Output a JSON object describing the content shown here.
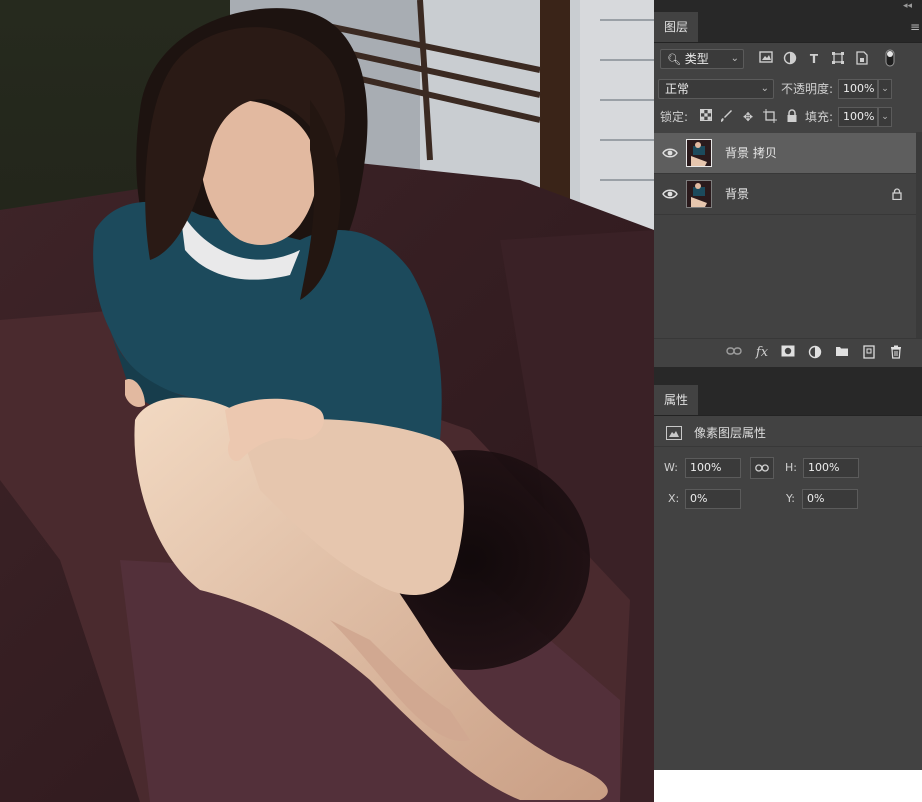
{
  "layers_panel": {
    "tab_label": "图层",
    "filter": {
      "kind_label": "类型"
    },
    "blend_mode": "正常",
    "opacity_label": "不透明度:",
    "opacity_value": "100%",
    "lock_label": "锁定:",
    "fill_label": "填充:",
    "fill_value": "100%",
    "layers": [
      {
        "name": "背景 拷贝",
        "selected": true,
        "locked": false
      },
      {
        "name": "背景",
        "selected": false,
        "locked": true
      }
    ],
    "footer_icons": [
      "link-icon",
      "fx-icon",
      "mask-icon",
      "adjustment-icon",
      "folder-icon",
      "new-layer-icon",
      "trash-icon"
    ]
  },
  "properties_panel": {
    "tab_label": "属性",
    "section_title": "像素图层属性",
    "w_label": "W:",
    "w_value": "100%",
    "h_label": "H:",
    "h_value": "100%",
    "x_label": "X:",
    "x_value": "0%",
    "y_label": "Y:",
    "y_value": "0%"
  },
  "colors": {
    "panel_bg": "#424242",
    "header_bg": "#282828",
    "selected_row": "#5e5e5e",
    "sofa": "#4a2a2e",
    "sweater": "#1c4a5c"
  }
}
